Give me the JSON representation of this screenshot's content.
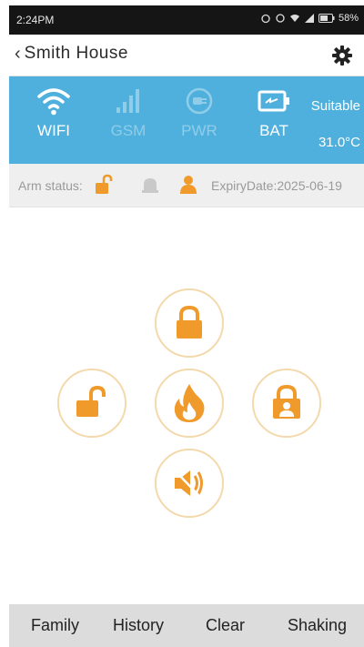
{
  "statusbar": {
    "time": "2:24PM",
    "battery": "58%"
  },
  "header": {
    "title": "Smith House",
    "back_icon": "chevron-left-icon",
    "settings_icon": "gear-icon"
  },
  "panel": {
    "wifi": {
      "label": "WIFI",
      "state": "on"
    },
    "gsm": {
      "label": "GSM",
      "state": "off"
    },
    "pwr": {
      "label": "PWR",
      "state": "off"
    },
    "bat": {
      "label": "BAT",
      "state": "on"
    },
    "status": "Suitable",
    "temperature": "31.0°C"
  },
  "info": {
    "arm_label": "Arm status:",
    "expiry": "ExpiryDate:2025-06-19"
  },
  "controls": {
    "arm": "lock-icon",
    "disarm": "unlock-icon",
    "panic": "fire-icon",
    "home_arm": "person-lock-icon",
    "mute": "speaker-mute-icon"
  },
  "nav": {
    "family": "Family",
    "history": "History",
    "clear": "Clear",
    "shaking": "Shaking"
  },
  "colors": {
    "accent": "#ef9a2b",
    "panel": "#4fb0de",
    "ring": "#f3d9ab"
  }
}
